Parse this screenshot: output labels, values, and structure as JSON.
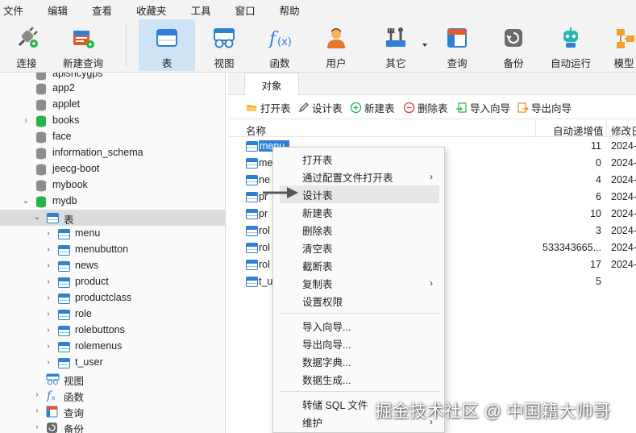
{
  "menubar": {
    "items": [
      "文件",
      "编辑",
      "查看",
      "收藏夹",
      "工具",
      "窗口",
      "帮助"
    ]
  },
  "toolbar": {
    "buttons": [
      {
        "label": "连接",
        "icon": "plug-connect-icon"
      },
      {
        "label": "新建查询",
        "icon": "new-query-icon"
      },
      {
        "label": "表",
        "icon": "table-icon",
        "active": true
      },
      {
        "label": "视图",
        "icon": "view-glasses-icon"
      },
      {
        "label": "函数",
        "icon": "function-fx-icon"
      },
      {
        "label": "用户",
        "icon": "user-icon"
      },
      {
        "label": "其它",
        "icon": "tools-icon"
      },
      {
        "label": "查询",
        "icon": "query-icon"
      },
      {
        "label": "备份",
        "icon": "backup-icon"
      },
      {
        "label": "自动运行",
        "icon": "robot-icon"
      },
      {
        "label": "模型",
        "icon": "model-icon"
      }
    ]
  },
  "tree": {
    "databases": [
      "apisncygps",
      "app2",
      "applet",
      "books",
      "face",
      "information_schema",
      "jeecg-boot",
      "mybook",
      "mydb"
    ],
    "mydb_children": {
      "tables_label": "表",
      "tables": [
        "menu",
        "menubutton",
        "news",
        "product",
        "productclass",
        "role",
        "rolebuttons",
        "rolemenus",
        "t_user"
      ],
      "views_label": "视图",
      "functions_label": "函数",
      "queries_label": "查询",
      "backups_label": "备份"
    }
  },
  "right": {
    "tab_label": "对象",
    "objbar": {
      "open": "打开表",
      "design": "设计表",
      "new": "新建表",
      "delete": "删除表",
      "import": "导入向导",
      "export": "导出向导"
    },
    "grid": {
      "columns": [
        "名称",
        "自动递增值",
        "修改日"
      ],
      "rows": [
        {
          "name": "menu",
          "auto_inc": "11",
          "modified": "2024-"
        },
        {
          "name": "me",
          "auto_inc": "0",
          "modified": "2024-"
        },
        {
          "name": "ne",
          "auto_inc": "4",
          "modified": "2024-"
        },
        {
          "name": "pr",
          "auto_inc": "6",
          "modified": "2024-"
        },
        {
          "name": "pr",
          "auto_inc": "10",
          "modified": "2024-"
        },
        {
          "name": "rol",
          "auto_inc": "3",
          "modified": "2024-"
        },
        {
          "name": "rol",
          "auto_inc": "533343665...",
          "modified": "2024-"
        },
        {
          "name": "rol",
          "auto_inc": "17",
          "modified": "2024-"
        },
        {
          "name": "t_u",
          "auto_inc": "5",
          "modified": ""
        }
      ]
    }
  },
  "context_menu": {
    "items": [
      "打开表",
      "通过配置文件打开表",
      "设计表",
      "新建表",
      "删除表",
      "清空表",
      "截断表",
      "复制表",
      "设置权限",
      "导入向导...",
      "导出向导...",
      "数据字典...",
      "数据生成...",
      "转储 SQL 文件",
      "维护"
    ]
  },
  "watermark": "掘金技术社区 @ 中国籍大帅哥",
  "colors": {
    "accent": "#2f7fd6",
    "selection": "#dcdcdc",
    "toolbar_active": "#cfe3f7",
    "db_green": "#27b24a",
    "db_gray": "#8c8c8c"
  }
}
